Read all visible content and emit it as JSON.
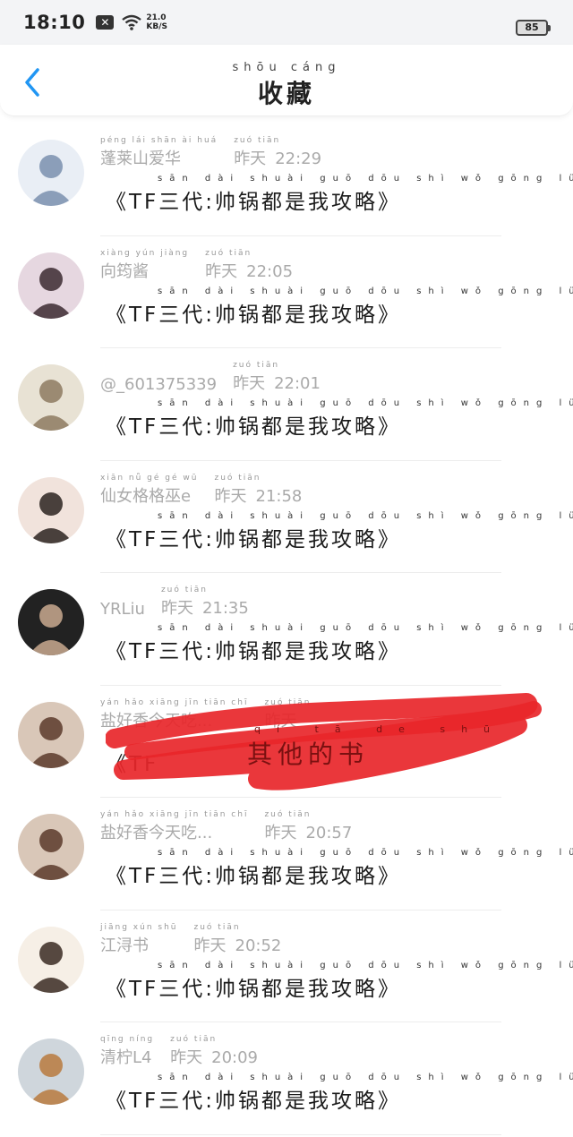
{
  "status": {
    "time": "18:10",
    "speed_value": "21.0",
    "speed_unit": "KB/S",
    "battery": "85"
  },
  "header": {
    "title_pinyin": "shōu cáng",
    "title": "收藏"
  },
  "favorites": [
    {
      "name_pinyin": "péng lái shān ài huá",
      "name": "蓬莱山爱华",
      "day_pinyin": "zuó tiān",
      "day": "昨天",
      "time": "22:29",
      "msg_pinyin": "sān dài shuài guō dōu shì wǒ gōng lüè",
      "message": "《TF三代:帅锅都是我攻略》"
    },
    {
      "name_pinyin": "xiàng yún jiàng",
      "name": "向筠酱",
      "day_pinyin": "zuó tiān",
      "day": "昨天",
      "time": "22:05",
      "msg_pinyin": "sān dài shuài guō dōu shì wǒ gōng lüè",
      "message": "《TF三代:帅锅都是我攻略》"
    },
    {
      "name_pinyin": "",
      "name": "@_601375339",
      "day_pinyin": "zuó tiān",
      "day": "昨天",
      "time": "22:01",
      "msg_pinyin": "sān dài shuài guō dōu shì wǒ gōng lüè",
      "message": "《TF三代:帅锅都是我攻略》"
    },
    {
      "name_pinyin": "xiān nǚ gé gé wū",
      "name": "仙女格格巫e",
      "day_pinyin": "zuó tiān",
      "day": "昨天",
      "time": "21:58",
      "msg_pinyin": "sān dài shuài guō dōu shì wǒ gōng lüè",
      "message": "《TF三代:帅锅都是我攻略》"
    },
    {
      "name_pinyin": "",
      "name": "YRLiu",
      "day_pinyin": "zuó tiān",
      "day": "昨天",
      "time": "21:35",
      "msg_pinyin": "sān dài shuài guō dōu shì wǒ gōng lüè",
      "message": "《TF三代:帅锅都是我攻略》"
    },
    {
      "name_pinyin": "yán hǎo xiāng jīn tiān chī",
      "name": "盐好香今天吃...",
      "day_pinyin": "zuó tiān",
      "day": "昨天",
      "time": "",
      "msg_pinyin": "",
      "message": "《TF"
    },
    {
      "name_pinyin": "yán hǎo xiāng jīn tiān chī",
      "name": "盐好香今天吃...",
      "day_pinyin": "zuó tiān",
      "day": "昨天",
      "time": "20:57",
      "msg_pinyin": "sān dài shuài guō dōu shì wǒ gōng lüè",
      "message": "《TF三代:帅锅都是我攻略》"
    },
    {
      "name_pinyin": "jiāng xún shū",
      "name": "江浔书",
      "day_pinyin": "zuó tiān",
      "day": "昨天",
      "time": "20:52",
      "msg_pinyin": "sān dài shuài guō dōu shì wǒ gōng lüè",
      "message": "《TF三代:帅锅都是我攻略》"
    },
    {
      "name_pinyin": "qīng níng",
      "name": "清柠L4",
      "day_pinyin": "zuó tiān",
      "day": "昨天",
      "time": "20:09",
      "msg_pinyin": "sān dài shuài guō dōu shì wǒ gōng lüè",
      "message": "《TF三代:帅锅都是我攻略》"
    }
  ],
  "overlay": {
    "pinyin": "qí tā de shū",
    "text": "其他的书"
  },
  "colors": {
    "accent": "#2196f3",
    "scribble": "#e8262a",
    "meta_text": "#aaaaaa"
  }
}
